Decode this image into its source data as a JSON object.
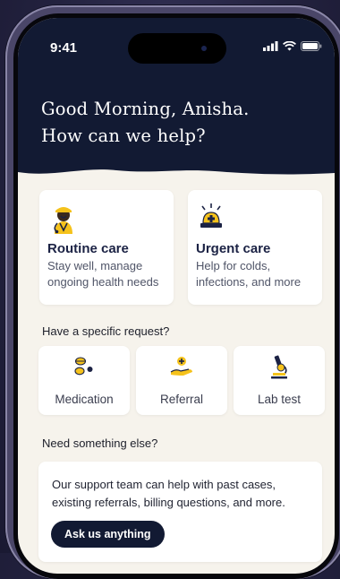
{
  "status_bar": {
    "time": "9:41"
  },
  "header": {
    "greeting_line1": "Good Morning, Anisha.",
    "greeting_line2": "How can we help?"
  },
  "care_options": [
    {
      "title": "Routine care",
      "subtitle_line1": "Stay well, manage",
      "subtitle_line2": "ongoing health needs",
      "icon": "doctor-icon"
    },
    {
      "title": "Urgent care",
      "subtitle_line1": "Help for colds,",
      "subtitle_line2": "infections, and more",
      "icon": "urgent-care-icon"
    }
  ],
  "specific_request": {
    "heading": "Have a specific request?",
    "items": [
      {
        "label": "Medication",
        "icon": "pills-icon"
      },
      {
        "label": "Referral",
        "icon": "referral-icon"
      },
      {
        "label": "Lab test",
        "icon": "microscope-icon"
      }
    ]
  },
  "support": {
    "heading": "Need something else?",
    "text_line1": "Our support team can help with past cases,",
    "text_line2": "existing referrals, billing questions, and more.",
    "button_label": "Ask us anything"
  },
  "colors": {
    "navy": "#121a33",
    "accent_yellow": "#f5c21b",
    "background": "#f6f3ec"
  }
}
